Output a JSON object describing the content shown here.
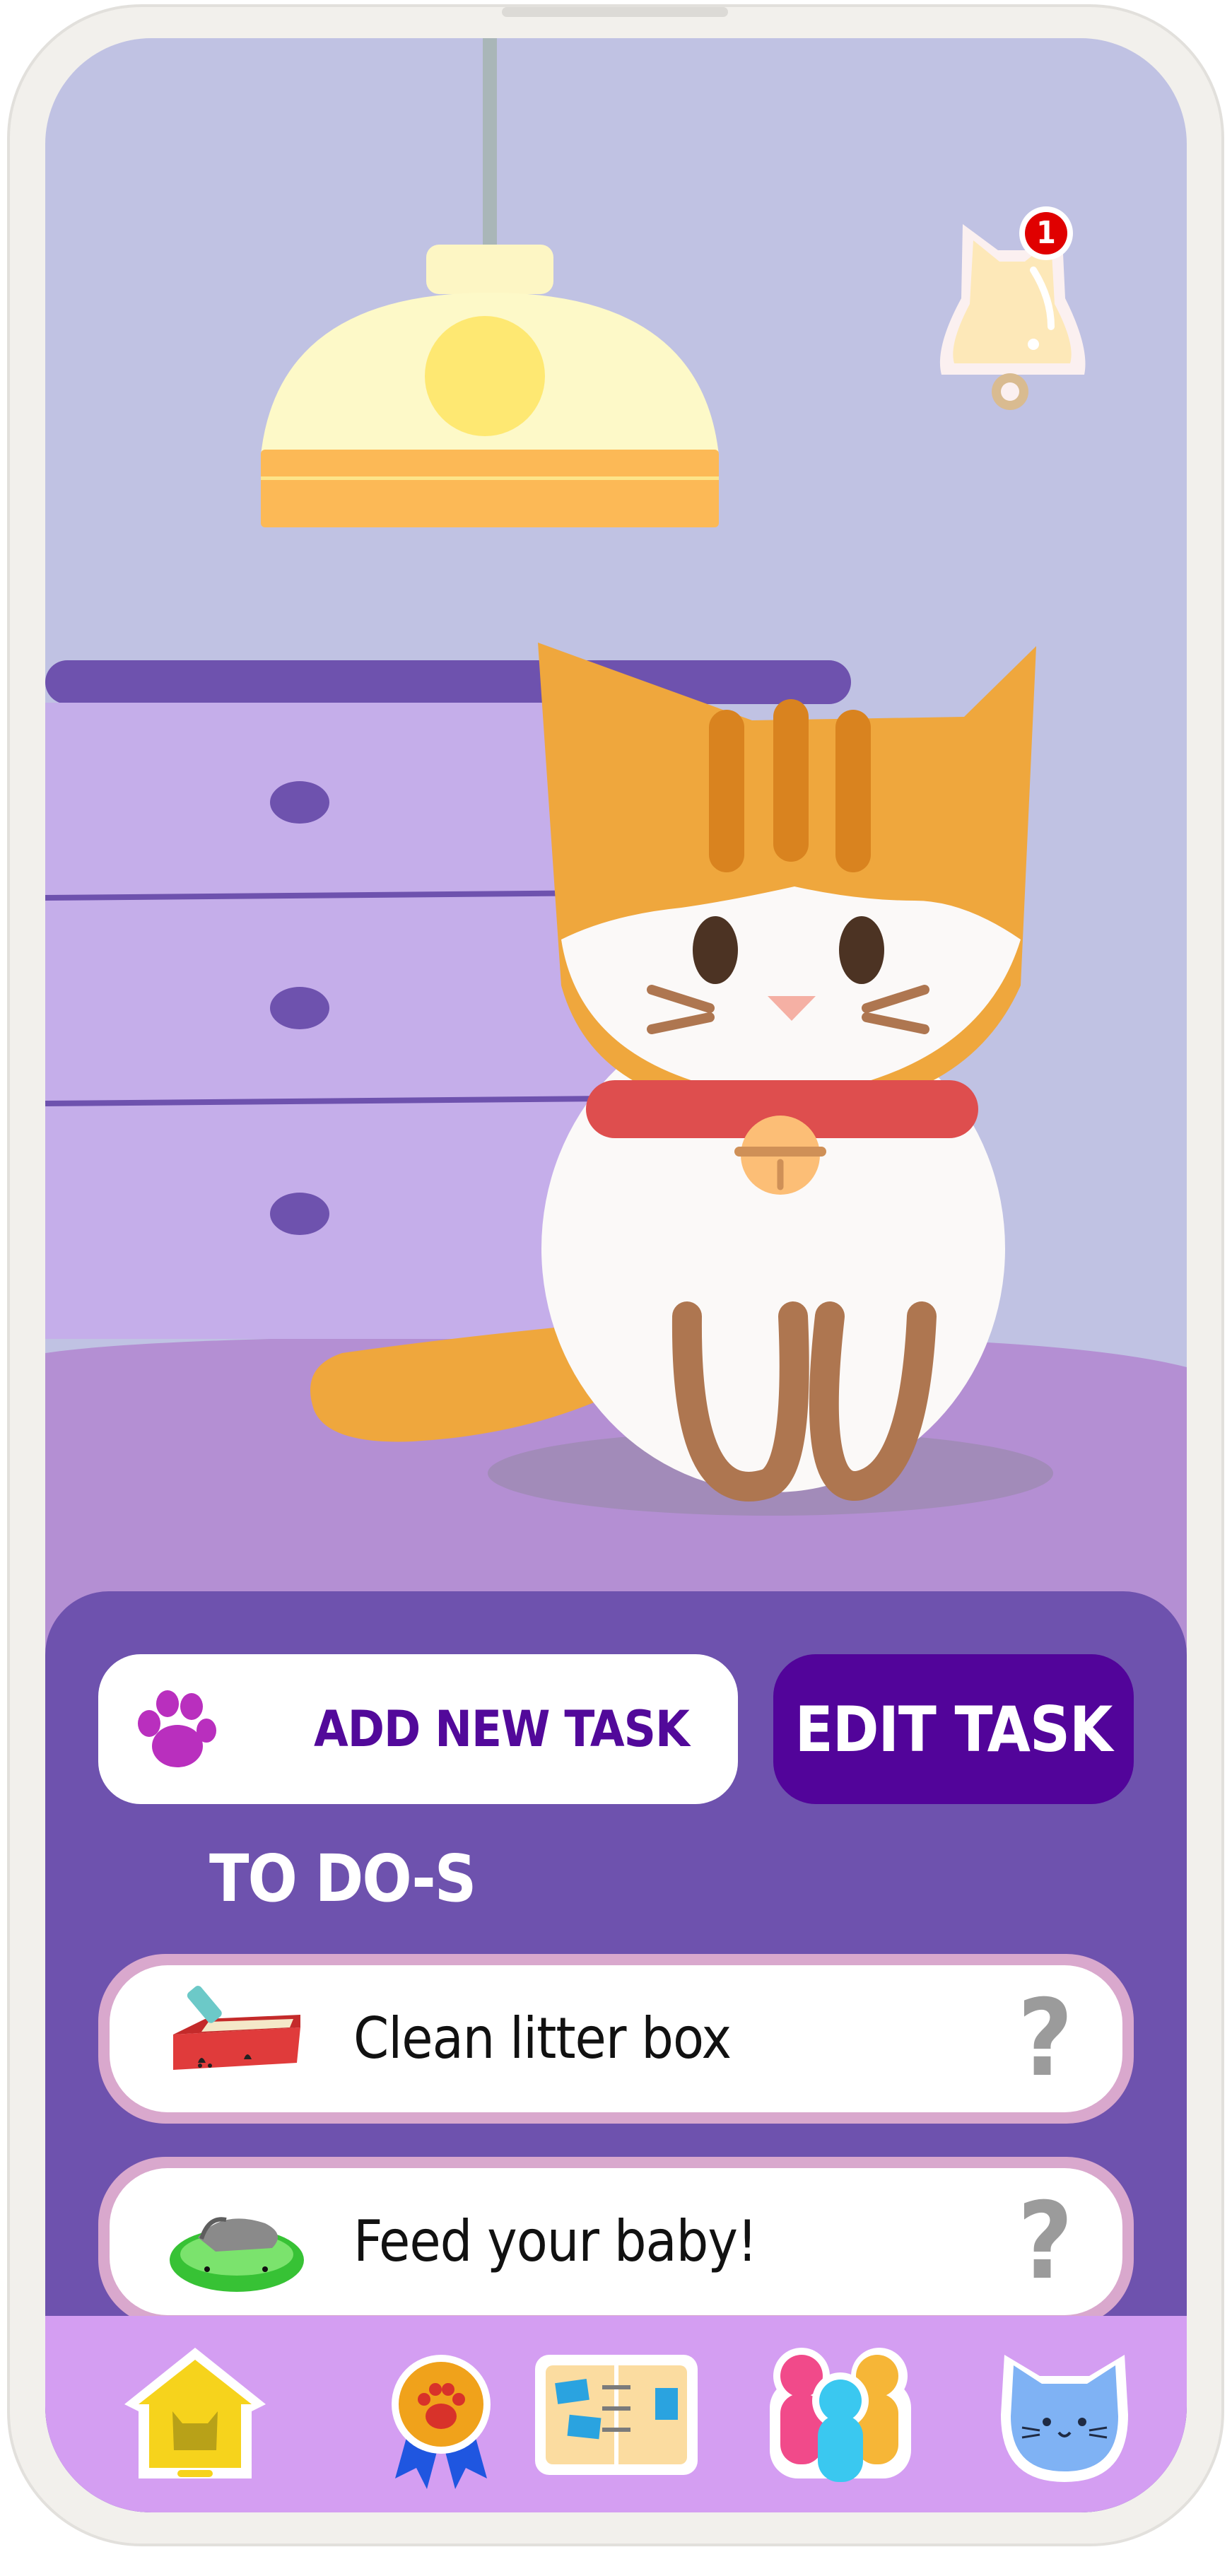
{
  "notifications": {
    "count": "1"
  },
  "actions": {
    "add_task_label": "ADD NEW TASK",
    "edit_task_label": "EDIT TASK"
  },
  "todo": {
    "title": "TO DO-S",
    "tasks": [
      {
        "label": "Clean litter box",
        "status": "?",
        "icon": "litter-box-icon"
      },
      {
        "label": "Feed your baby!",
        "status": "?",
        "icon": "food-bowl-icon"
      }
    ]
  },
  "nav": {
    "items": [
      {
        "icon": "cat-house-icon"
      },
      {
        "icon": "paw-medal-icon"
      },
      {
        "icon": "schedule-board-icon"
      },
      {
        "icon": "family-icon"
      },
      {
        "icon": "cat-profile-icon"
      }
    ]
  },
  "colors": {
    "panel": "#6e52ae",
    "accent": "#52049a",
    "scene_wall": "#c0c2e3",
    "nav_bar": "#d49ef2",
    "notification_badge": "#e00000"
  }
}
